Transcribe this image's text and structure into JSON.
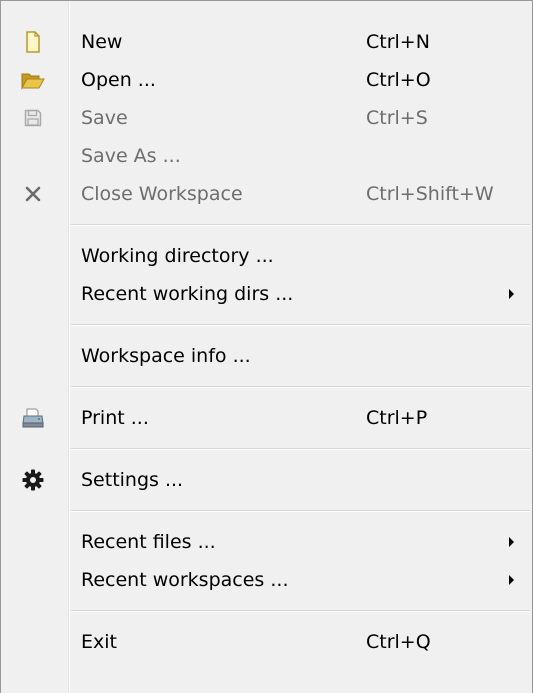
{
  "menu": {
    "items": [
      {
        "label": "New",
        "shortcut": "Ctrl+N",
        "icon": "new-file-icon",
        "enabled": true
      },
      {
        "label": "Open ...",
        "shortcut": "Ctrl+O",
        "icon": "open-folder-icon",
        "enabled": true
      },
      {
        "label": "Save",
        "shortcut": "Ctrl+S",
        "icon": "save-icon",
        "enabled": false
      },
      {
        "label": "Save As ...",
        "shortcut": "",
        "icon": "",
        "enabled": false
      },
      {
        "label": "Close Workspace",
        "shortcut": "Ctrl+Shift+W",
        "icon": "close-icon",
        "enabled": false
      },
      {
        "label": "Working directory ...",
        "shortcut": "",
        "icon": "",
        "enabled": true
      },
      {
        "label": "Recent working dirs ...",
        "shortcut": "",
        "icon": "",
        "enabled": true,
        "submenu": true
      },
      {
        "label": "Workspace info ...",
        "shortcut": "",
        "icon": "",
        "enabled": true
      },
      {
        "label": "Print ...",
        "shortcut": "Ctrl+P",
        "icon": "printer-icon",
        "enabled": true
      },
      {
        "label": "Settings ...",
        "shortcut": "",
        "icon": "gear-icon",
        "enabled": true
      },
      {
        "label": "Recent files ...",
        "shortcut": "",
        "icon": "",
        "enabled": true,
        "submenu": true
      },
      {
        "label": "Recent workspaces ...",
        "shortcut": "",
        "icon": "",
        "enabled": true,
        "submenu": true
      },
      {
        "label": "Exit",
        "shortcut": "Ctrl+Q",
        "icon": "",
        "enabled": true
      }
    ]
  },
  "colors": {
    "menu_background": "#f0f0f0",
    "disabled_text": "#6d6d6d",
    "folder_icon": "#d8b23a"
  }
}
